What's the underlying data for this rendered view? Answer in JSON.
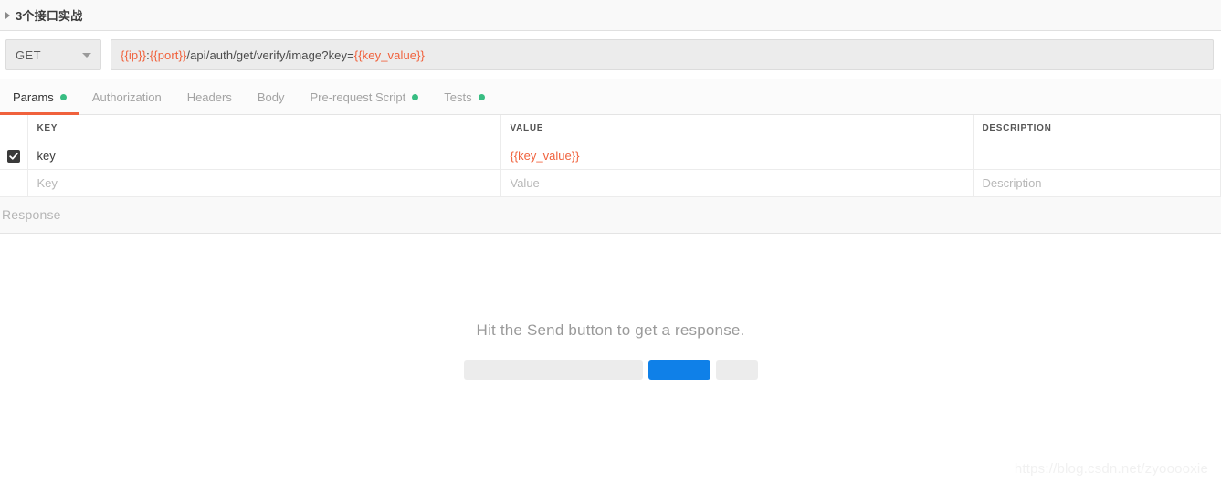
{
  "collection": {
    "title": "3个接口实战",
    "collapse_icon": "triangle-right-icon"
  },
  "request": {
    "method": "GET",
    "method_caret_icon": "chevron-down-icon",
    "url_parts": [
      {
        "text": "{{ip}}",
        "variable": true
      },
      {
        "text": ":",
        "variable": false
      },
      {
        "text": "{{port}}",
        "variable": true
      },
      {
        "text": "/api/auth/get/verify/image?key=",
        "variable": false
      },
      {
        "text": "{{key_value}}",
        "variable": true
      }
    ],
    "url_full": "{{ip}}:{{port}}/api/auth/get/verify/image?key={{key_value}}"
  },
  "tabs": [
    {
      "label": "Params",
      "active": true,
      "dot": true
    },
    {
      "label": "Authorization",
      "active": false,
      "dot": false
    },
    {
      "label": "Headers",
      "active": false,
      "dot": false
    },
    {
      "label": "Body",
      "active": false,
      "dot": false
    },
    {
      "label": "Pre-request Script",
      "active": false,
      "dot": true
    },
    {
      "label": "Tests",
      "active": false,
      "dot": true
    }
  ],
  "params_table": {
    "headers": {
      "key": "KEY",
      "value": "VALUE",
      "description": "DESCRIPTION"
    },
    "rows": [
      {
        "checked": true,
        "key": "key",
        "value": "{{key_value}}",
        "value_is_variable": true,
        "description": ""
      }
    ],
    "placeholder_row": {
      "key": "Key",
      "value": "Value",
      "description": "Description"
    }
  },
  "response": {
    "label": "Response",
    "empty_message": "Hit the Send button to get a response.",
    "mock": {
      "button_color": "#0f80e8",
      "bar_color": "#ececec"
    }
  },
  "watermark": "https://blog.csdn.net/zyooooxie",
  "colors": {
    "accent_orange": "#f0613c",
    "green_dot": "#38bd82",
    "blue_button": "#0f80e8",
    "variable_text": "#f0613c"
  }
}
